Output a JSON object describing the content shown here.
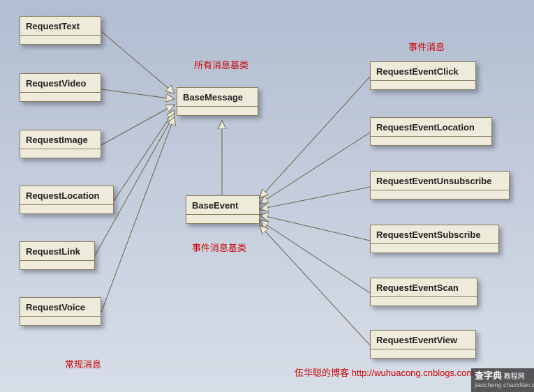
{
  "labels": {
    "base_msg_label": "所有消息基类",
    "base_event_label": "事件消息基类",
    "regular_msg_label": "常规消息",
    "event_msg_label": "事件消息",
    "blog_label": "伍华聪的博客 http://wuhuacong.cnblogs.com"
  },
  "watermark": {
    "line1": "查字典",
    "line2": "教程网",
    "line3": "jiaocheng.chazidian.com"
  },
  "boxes": {
    "BaseMessage": "BaseMessage",
    "BaseEvent": "BaseEvent",
    "RequestText": "RequestText",
    "RequestVideo": "RequestVideo",
    "RequestImage": "RequestImage",
    "RequestLocation": "RequestLocation",
    "RequestLink": "RequestLink",
    "RequestVoice": "RequestVoice",
    "RequestEventClick": "RequestEventClick",
    "RequestEventLocation": "RequestEventLocation",
    "RequestEventUnsubscribe": "RequestEventUnsubscribe",
    "RequestEventSubscribe": "RequestEventSubscribe",
    "RequestEventScan": "RequestEventScan",
    "RequestEventView": "RequestEventView"
  },
  "chart_data": {
    "type": "table",
    "description": "UML class inheritance diagram",
    "nodes": [
      {
        "id": "BaseMessage",
        "is_root": true,
        "label": "所有消息基类"
      },
      {
        "id": "BaseEvent",
        "label": "事件消息基类"
      },
      {
        "id": "RequestText"
      },
      {
        "id": "RequestVideo"
      },
      {
        "id": "RequestImage"
      },
      {
        "id": "RequestLocation"
      },
      {
        "id": "RequestLink"
      },
      {
        "id": "RequestVoice"
      },
      {
        "id": "RequestEventClick"
      },
      {
        "id": "RequestEventLocation"
      },
      {
        "id": "RequestEventUnsubscribe"
      },
      {
        "id": "RequestEventSubscribe"
      },
      {
        "id": "RequestEventScan"
      },
      {
        "id": "RequestEventView"
      }
    ],
    "edges_generalization": [
      {
        "child": "RequestText",
        "parent": "BaseMessage"
      },
      {
        "child": "RequestVideo",
        "parent": "BaseMessage"
      },
      {
        "child": "RequestImage",
        "parent": "BaseMessage"
      },
      {
        "child": "RequestLocation",
        "parent": "BaseMessage"
      },
      {
        "child": "RequestLink",
        "parent": "BaseMessage"
      },
      {
        "child": "RequestVoice",
        "parent": "BaseMessage"
      },
      {
        "child": "BaseEvent",
        "parent": "BaseMessage"
      },
      {
        "child": "RequestEventClick",
        "parent": "BaseEvent"
      },
      {
        "child": "RequestEventLocation",
        "parent": "BaseEvent"
      },
      {
        "child": "RequestEventUnsubscribe",
        "parent": "BaseEvent"
      },
      {
        "child": "RequestEventSubscribe",
        "parent": "BaseEvent"
      },
      {
        "child": "RequestEventScan",
        "parent": "BaseEvent"
      },
      {
        "child": "RequestEventView",
        "parent": "BaseEvent"
      }
    ],
    "groups": [
      {
        "label": "常规消息",
        "members": [
          "RequestText",
          "RequestVideo",
          "RequestImage",
          "RequestLocation",
          "RequestLink",
          "RequestVoice"
        ]
      },
      {
        "label": "事件消息",
        "members": [
          "RequestEventClick",
          "RequestEventLocation",
          "RequestEventUnsubscribe",
          "RequestEventSubscribe",
          "RequestEventScan",
          "RequestEventView"
        ]
      }
    ]
  }
}
